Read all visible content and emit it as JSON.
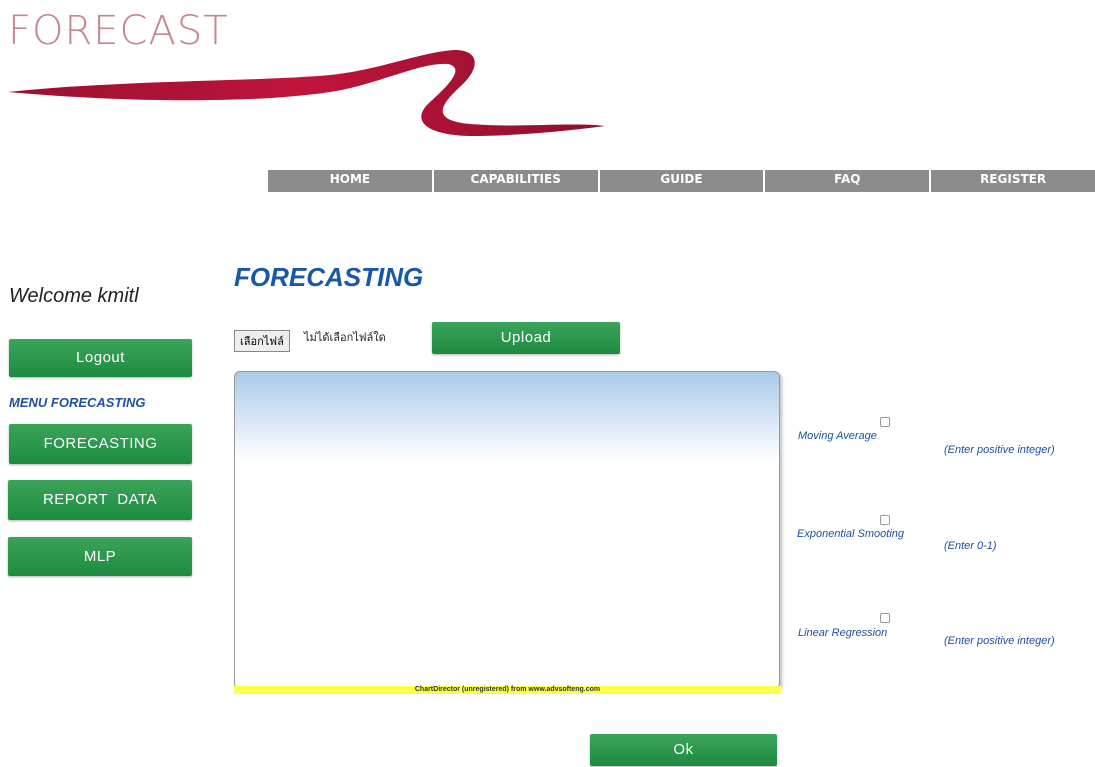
{
  "logo": {
    "text": "FORECAST"
  },
  "nav": {
    "items": [
      {
        "label": "HOME"
      },
      {
        "label": "CAPABILITIES"
      },
      {
        "label": "GUIDE"
      },
      {
        "label": "FAQ"
      },
      {
        "label": "REGISTER"
      }
    ]
  },
  "sidebar": {
    "welcome": "Welcome kmitl",
    "logout_label": "Logout",
    "menu_title": "MENU FORECASTING",
    "items": [
      {
        "label": "FORECASTING"
      },
      {
        "label": "REPORT  DATA"
      },
      {
        "label": "MLP"
      }
    ]
  },
  "main": {
    "title": "FORECASTING",
    "file_button": "เลือกไฟล์",
    "file_status": "ไม่ได้เลือกไฟล์ใด",
    "upload_label": "Upload",
    "chart_watermark": "ChartDirector (unregistered) from www.advsofteng.com",
    "ok_label": "Ok"
  },
  "options": [
    {
      "label": "Moving Average",
      "hint": "(Enter positive integer)"
    },
    {
      "label": "Exponential Smooting",
      "hint": "(Enter 0-1)"
    },
    {
      "label": "Linear Regression",
      "hint": "(Enter positive integer)"
    }
  ],
  "colors": {
    "accent_green": "#2a9a4c",
    "nav_gray": "#8c8c8c",
    "title_blue": "#1858a8",
    "swoosh_red": "#b3163a"
  }
}
